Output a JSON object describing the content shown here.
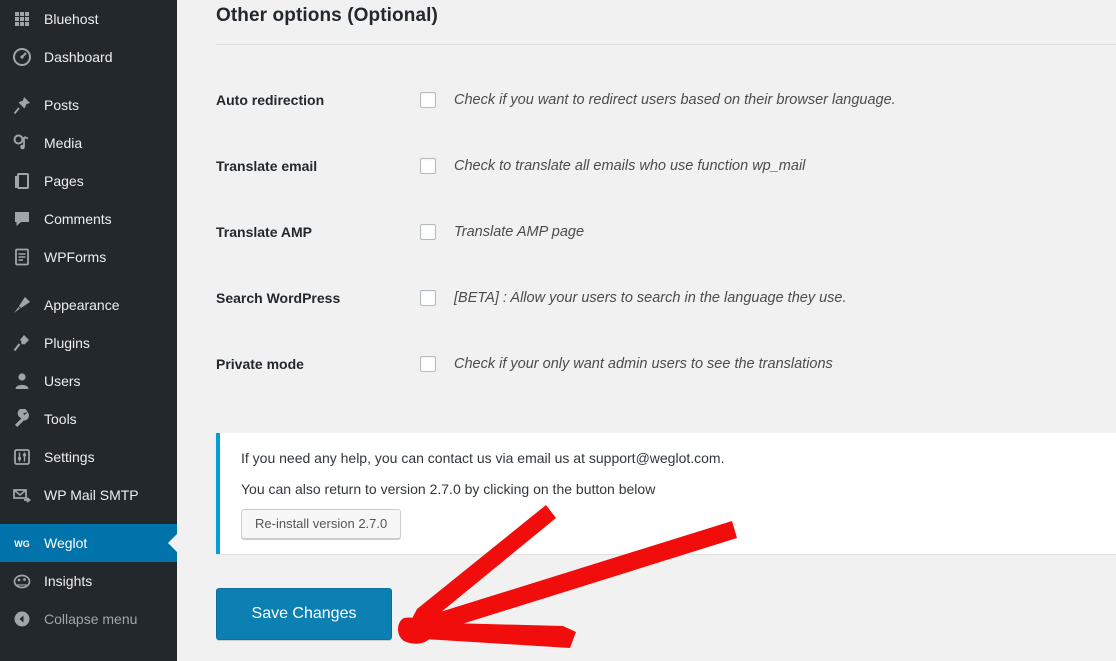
{
  "sidebar": {
    "items": [
      {
        "label": "Bluehost",
        "icon": "grid-icon",
        "style": "strong",
        "active": false,
        "gap_after": false
      },
      {
        "label": "Dashboard",
        "icon": "dashboard-icon",
        "style": "strong",
        "active": false,
        "gap_after": true
      },
      {
        "label": "Posts",
        "icon": "pin-icon",
        "style": "strong",
        "active": false,
        "gap_after": false
      },
      {
        "label": "Media",
        "icon": "media-icon",
        "style": "strong",
        "active": false,
        "gap_after": false
      },
      {
        "label": "Pages",
        "icon": "pages-icon",
        "style": "strong",
        "active": false,
        "gap_after": false
      },
      {
        "label": "Comments",
        "icon": "comments-icon",
        "style": "strong",
        "active": false,
        "gap_after": false
      },
      {
        "label": "WPForms",
        "icon": "wpforms-icon",
        "style": "strong",
        "active": false,
        "gap_after": true
      },
      {
        "label": "Appearance",
        "icon": "brush-icon",
        "style": "strong",
        "active": false,
        "gap_after": false
      },
      {
        "label": "Plugins",
        "icon": "plug-icon",
        "style": "strong",
        "active": false,
        "gap_after": false
      },
      {
        "label": "Users",
        "icon": "user-icon",
        "style": "strong",
        "active": false,
        "gap_after": false
      },
      {
        "label": "Tools",
        "icon": "wrench-icon",
        "style": "strong",
        "active": false,
        "gap_after": false
      },
      {
        "label": "Settings",
        "icon": "sliders-icon",
        "style": "strong",
        "active": false,
        "gap_after": false
      },
      {
        "label": "WP Mail SMTP",
        "icon": "mail-send-icon",
        "style": "strong",
        "active": false,
        "gap_after": true
      },
      {
        "label": "Weglot",
        "icon": "weglot-icon",
        "style": "strong",
        "active": true,
        "gap_after": false
      },
      {
        "label": "Insights",
        "icon": "insights-icon",
        "style": "strong",
        "active": false,
        "gap_after": false
      },
      {
        "label": "Collapse menu",
        "icon": "collapse-icon",
        "style": "dim",
        "active": false,
        "gap_after": false
      }
    ]
  },
  "main": {
    "page_title": "Other options (Optional)",
    "options": [
      {
        "label": "Auto redirection",
        "description": "Check if you want to redirect users based on their browser language.",
        "checked": false
      },
      {
        "label": "Translate email",
        "description": "Check to translate all emails who use function wp_mail",
        "checked": false
      },
      {
        "label": "Translate AMP",
        "description": "Translate AMP page",
        "checked": false
      },
      {
        "label": "Search WordPress",
        "description": "[BETA] : Allow your users to search in the language they use.",
        "checked": false
      },
      {
        "label": "Private mode",
        "description": "Check if your only want admin users to see the translations",
        "checked": false
      }
    ],
    "notice": {
      "line1": "If you need any help, you can contact us via email us at support@weglot.com.",
      "line2": "You can also return to version 2.7.0 by clicking on the button below",
      "button_label": "Re-install version 2.7.0",
      "accent_color": "#00a0d2"
    },
    "save_button_label": "Save Changes",
    "save_button_color": "#0d80b3"
  },
  "annotation": {
    "type": "hand-drawn-arrow",
    "color": "#f20d0d",
    "points_to": "save-changes-button"
  }
}
